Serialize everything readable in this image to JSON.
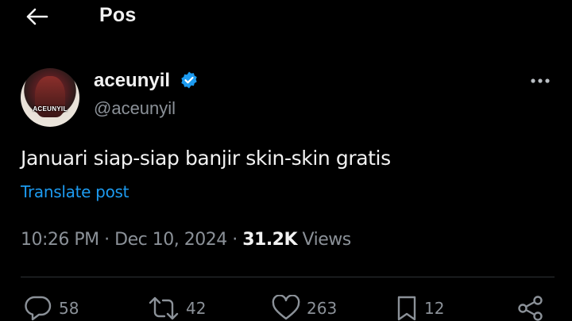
{
  "header": {
    "title": "Pos",
    "back_icon": "arrow-left-icon"
  },
  "author": {
    "display_name": "aceunyil",
    "handle": "@aceunyil",
    "verified": true,
    "avatar_text": "ACEUNYIL"
  },
  "post": {
    "text": "Januari siap-siap banjir skin-skin gratis",
    "translate_label": "Translate post",
    "time": "10:26 PM",
    "date": "Dec 10, 2024",
    "separator": "·",
    "views_count": "31.2K",
    "views_label": "Views"
  },
  "actions": {
    "replies": "58",
    "reposts": "42",
    "likes": "263",
    "bookmarks": "12"
  },
  "colors": {
    "background": "#000000",
    "accent": "#1d9bf0",
    "muted": "#8b9198",
    "text": "#f2f2f2"
  }
}
